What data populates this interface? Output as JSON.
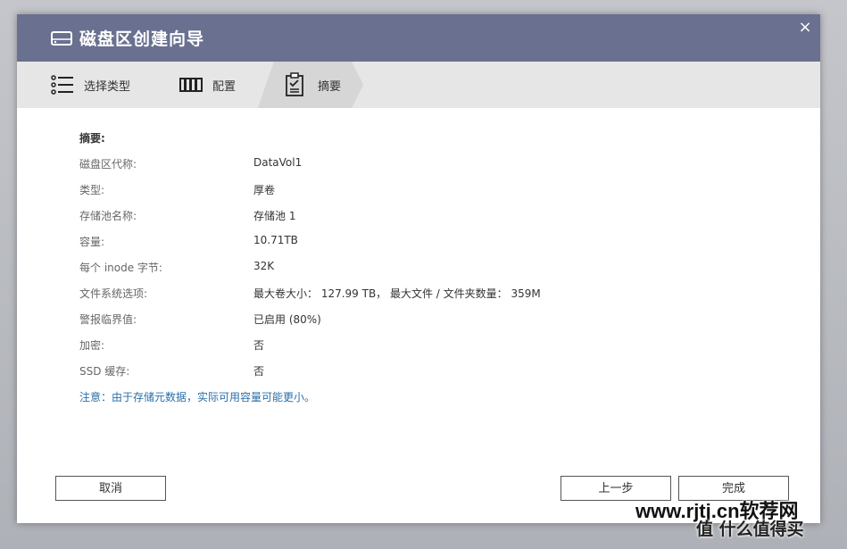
{
  "dialog": {
    "title": "磁盘区创建向导",
    "close_symbol": "×"
  },
  "steps": [
    {
      "label": "选择类型",
      "icon": "list-icon"
    },
    {
      "label": "配置",
      "icon": "config-icon"
    },
    {
      "label": "摘要",
      "icon": "clipboard-check-icon"
    }
  ],
  "summary": {
    "heading": "摘要:",
    "rows": [
      {
        "key": "磁盘区代称:",
        "value": "DataVol1"
      },
      {
        "key": "类型:",
        "value": "厚卷"
      },
      {
        "key": "存储池名称:",
        "value": "存储池 1"
      },
      {
        "key": "容量:",
        "value": "10.71TB"
      },
      {
        "key": "每个 inode 字节:",
        "value": "32K"
      },
      {
        "key": "文件系统选项:",
        "value": "最大卷大小： 127.99 TB， 最大文件 / 文件夹数量： 359M"
      },
      {
        "key": "警报临界值:",
        "value": "已启用 (80%)"
      },
      {
        "key": "加密:",
        "value": "否"
      },
      {
        "key": "SSD 缓存:",
        "value": "否"
      }
    ],
    "note": "注意：由于存储元数据，实际可用容量可能更小。"
  },
  "buttons": {
    "cancel": "取消",
    "prev": "上一步",
    "finish": "完成"
  },
  "watermark": {
    "line1": "www.rjtj.cn软荐网",
    "line2": "值 什么值得买"
  },
  "colors": {
    "titlebar": "#6a7090",
    "stepbar": "#e6e6e6",
    "note": "#2a6fa8"
  }
}
